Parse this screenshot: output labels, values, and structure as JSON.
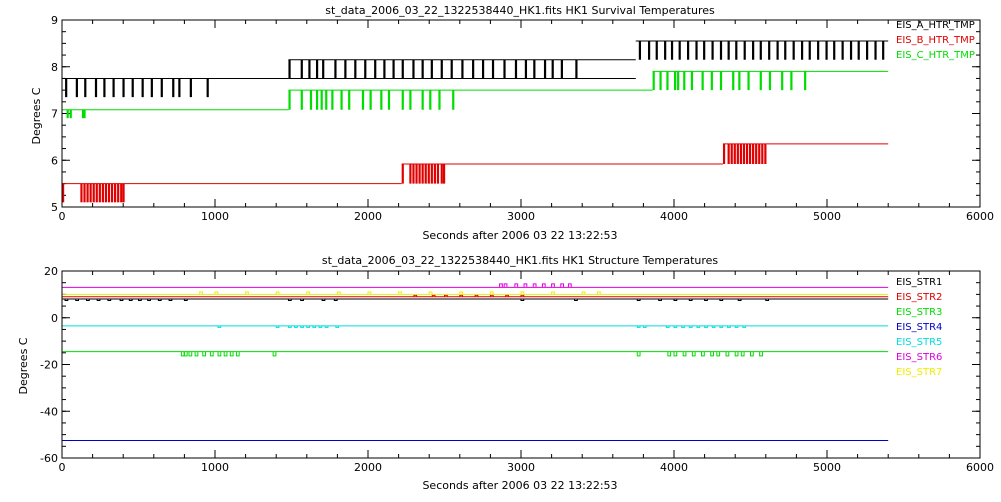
{
  "chart_data": [
    {
      "type": "line",
      "title": "st_data_2006_03_22_1322538440_HK1.fits HK1 Survival Temperatures",
      "xlabel": "Seconds after 2006 03 22 13:22:53",
      "ylabel": "Degrees C",
      "xlim": [
        0,
        6000
      ],
      "ylim": [
        5,
        9
      ],
      "xticks": [
        "0",
        "1000",
        "2000",
        "3000",
        "4000",
        "5000",
        "6000"
      ],
      "yticks": [
        "5",
        "6",
        "7",
        "8",
        "9"
      ],
      "grid": false,
      "legend_position": "top-right",
      "series": [
        {
          "name": "EIS_A_HTR_TMP",
          "color": "#000000",
          "segments": [
            {
              "x": [
                0,
                1480
              ],
              "base": 7.75,
              "low": 7.35,
              "x_pulses": [
                20,
                90,
                145,
                215,
                270,
                330,
                395,
                455,
                520,
                580,
                645,
                720,
                760,
                835,
                945
              ]
            },
            {
              "x": [
                1480,
                3750
              ],
              "base": 7.75,
              "low": 7.75,
              "x_pulses": []
            },
            {
              "x": [
                1480,
                3750
              ],
              "base": 8.15,
              "low": 7.75,
              "x_pulses": [
                1480,
                1560,
                1610,
                1660,
                1700,
                1780,
                1845,
                1910,
                1975,
                2040,
                2100,
                2160,
                2220,
                2290,
                2350,
                2410,
                2475,
                2540,
                2610,
                2680,
                2745,
                2810,
                2885,
                2960,
                3025,
                3080,
                3150,
                3200,
                3260,
                3355
              ]
            },
            {
              "x": [
                3750,
                5400
              ],
              "base": 8.55,
              "low": 8.15,
              "x_pulses": [
                3770,
                3830,
                3880,
                3935,
                3980,
                4030,
                4085,
                4140,
                4190,
                4245,
                4300,
                4350,
                4400,
                4455,
                4510,
                4560,
                4615,
                4670,
                4720,
                4775,
                4830,
                4880,
                4935,
                4990,
                5040,
                5095,
                5150,
                5200,
                5255,
                5310,
                5360
              ]
            }
          ]
        },
        {
          "name": "EIS_B_HTR_TMP",
          "color": "#e00000",
          "segments": [
            {
              "x": [
                0,
                2220
              ],
              "base": 5.5,
              "low": 5.1,
              "x_pulses": [
                0,
                120,
                140,
                160,
                180,
                200,
                220,
                240,
                260,
                280,
                300,
                320,
                340,
                360,
                380,
                395
              ]
            },
            {
              "x": [
                2220,
                4320
              ],
              "base": 5.92,
              "low": 5.5,
              "x_pulses": [
                2220,
                2270,
                2290,
                2310,
                2330,
                2350,
                2370,
                2390,
                2410,
                2430,
                2450,
                2475,
                2490
              ]
            },
            {
              "x": [
                4320,
                5400
              ],
              "base": 6.35,
              "low": 5.92,
              "x_pulses": [
                4320,
                4350,
                4370,
                4390,
                4410,
                4430,
                4450,
                4470,
                4490,
                4510,
                4530,
                4550,
                4570,
                4590
              ]
            }
          ]
        },
        {
          "name": "EIS_C_HTR_TMP",
          "color": "#00dd00",
          "segments": [
            {
              "x": [
                0,
                1480
              ],
              "base": 7.08,
              "low": 6.9,
              "x_pulses": [
                30,
                50,
                130,
                140
              ]
            },
            {
              "x": [
                1480,
                3860
              ],
              "base": 7.5,
              "low": 7.08,
              "x_pulses": [
                1480,
                1560,
                1620,
                1660,
                1690,
                1720,
                1760,
                1820,
                1870,
                1960,
                2010,
                2080,
                2130,
                2220,
                2270,
                2350,
                2400,
                2460,
                2550
              ]
            },
            {
              "x": [
                3860,
                5400
              ],
              "base": 7.9,
              "low": 7.5,
              "x_pulses": [
                3860,
                3905,
                3950,
                4000,
                4020,
                4060,
                4110,
                4180,
                4240,
                4300,
                4380,
                4420,
                4480,
                4560,
                4620,
                4700,
                4760,
                4850
              ]
            }
          ]
        }
      ]
    },
    {
      "type": "line",
      "title": "st_data_2006_03_22_1322538440_HK1.fits HK1 Structure Temperatures",
      "xlabel": "Seconds after 2006 03 22 13:22:53",
      "ylabel": "Degrees C",
      "xlim": [
        0,
        6000
      ],
      "ylim": [
        -60,
        20
      ],
      "xticks": [
        "0",
        "1000",
        "2000",
        "3000",
        "4000",
        "5000",
        "6000"
      ],
      "yticks": [
        "-60",
        "-40",
        "-20",
        "0",
        "20"
      ],
      "grid": false,
      "legend_position": "top-right",
      "series": [
        {
          "name": "EIS_STR1",
          "color": "#000000",
          "base": 8.0,
          "dip": -0.6,
          "x_pulses": [
            20,
            90,
            160,
            230,
            300,
            380,
            440,
            500,
            560,
            630,
            700,
            800,
            1480,
            1560,
            1700,
            1780,
            3000,
            3350,
            3760,
            3900,
            4000,
            4100,
            4200,
            4300,
            4420,
            4600
          ]
        },
        {
          "name": "EIS_STR2",
          "color": "#e00000",
          "base": 9.0,
          "dip": 0.6,
          "x_pulses": [
            2300,
            2420,
            2500,
            2600,
            2700,
            2800,
            2900,
            3000
          ]
        },
        {
          "name": "EIS_STR3",
          "color": "#00dd00",
          "base": -14.5,
          "dip": -1.8,
          "x_pulses": [
            780,
            800,
            830,
            870,
            920,
            970,
            1020,
            1060,
            1100,
            1140,
            1380,
            3760,
            3960,
            4000,
            4060,
            4120,
            4180,
            4240,
            4280,
            4340,
            4400,
            4440,
            4500,
            4560
          ]
        },
        {
          "name": "EIS_STR4",
          "color": "#0000cc",
          "base": -52.5,
          "dip": 0,
          "x_pulses": []
        },
        {
          "name": "EIS_STR5",
          "color": "#00dddd",
          "base": -3.5,
          "dip": -0.6,
          "x_pulses": [
            1020,
            1400,
            1480,
            1520,
            1560,
            1600,
            1640,
            1680,
            1720,
            1790,
            3760,
            3800,
            3950,
            4000,
            4050,
            4100,
            4150,
            4200,
            4250,
            4300,
            4350,
            4400,
            4450
          ]
        },
        {
          "name": "EIS_STR6",
          "color": "#dd00dd",
          "base": 13.0,
          "dip": 1.5,
          "x_pulses": [
            2860,
            2890,
            2960,
            3020,
            3080,
            3140,
            3200,
            3260,
            3310
          ]
        },
        {
          "name": "EIS_STR7",
          "color": "#eeee00",
          "base": 10.0,
          "dip": 1.0,
          "x_pulses": [
            900,
            1000,
            1200,
            1400,
            1600,
            1800,
            2000,
            2200,
            2400,
            2600,
            2800,
            3000,
            3200,
            3400,
            3500
          ]
        }
      ]
    }
  ]
}
